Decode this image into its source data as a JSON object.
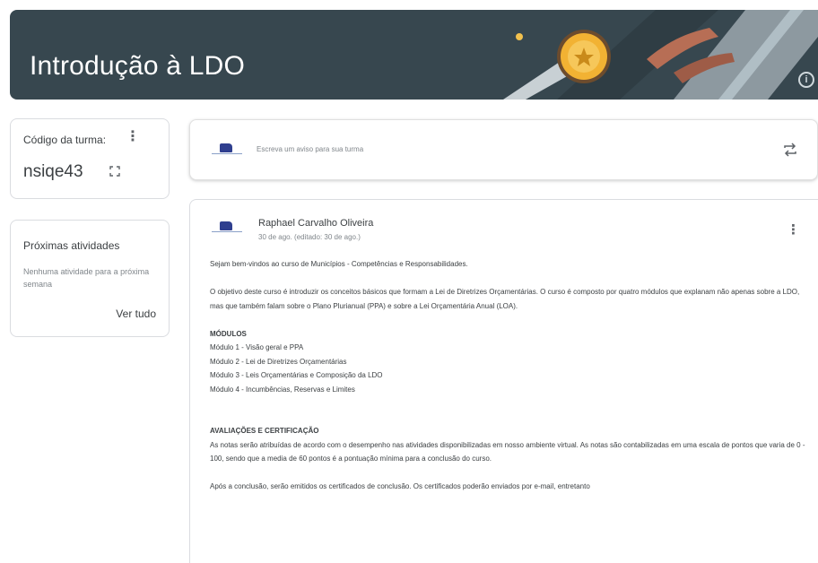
{
  "banner": {
    "title": "Introdução à LDO",
    "colors": {
      "background": "#37474f",
      "accent_gold": "#f2b233",
      "ribbon": "#b76e55"
    }
  },
  "class_code": {
    "label": "Código da turma:",
    "value": "nsiqe43"
  },
  "upcoming": {
    "title": "Próximas atividades",
    "empty_text": "Nenhuma atividade para a próxima semana",
    "view_all": "Ver tudo"
  },
  "announce": {
    "placeholder": "Escreva um aviso para sua turma"
  },
  "post": {
    "author": "Raphael Carvalho Oliveira",
    "date": "30 de ago. (editado: 30 de ago.)",
    "p1": "Sejam bem-vindos ao curso de Municípios - Competências e Responsabilidades.",
    "p2": "O objetivo deste curso é introduzir os conceitos básicos que formam a Lei de Diretrizes Orçamentárias. O curso é composto por quatro módulos que explanam não apenas sobre a LDO, mas que também falam sobre o Plano Plurianual (PPA) e sobre a Lei Orçamentária Anual (LOA).",
    "modules_heading": "MÓDULOS",
    "modules": [
      "Módulo 1 - Visão geral e PPA",
      "Módulo 2 - Lei de Diretrizes Orçamentárias",
      "Módulo 3 - Leis Orçamentárias e Composição da LDO",
      "Módulo 4 - Incumbências, Reservas e Limites"
    ],
    "eval_heading": "AVALIAÇÕES E CERTIFICAÇÃO",
    "eval_text": "As notas serão atribuídas de acordo com o desempenho nas atividades disponibilizadas em nosso ambiente virtual. As notas são contabilizadas em uma escala de pontos que varia de 0 - 100, sendo que a media de 60 pontos é a pontuação mínima para a conclusão do curso.",
    "cert_text": "Após a conclusão, serão emitidos os certificados de conclusão. Os certificados poderão enviados por e-mail, entretanto"
  }
}
